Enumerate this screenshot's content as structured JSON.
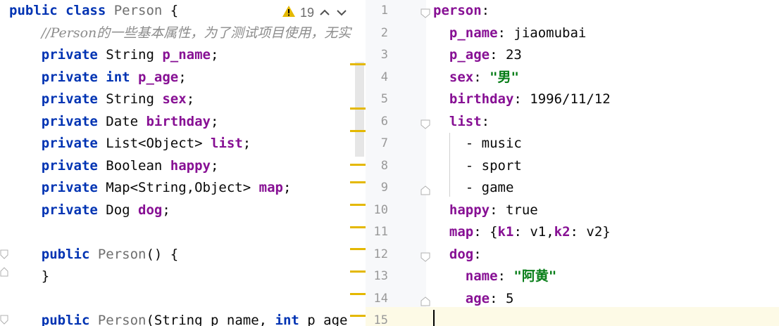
{
  "left_editor": {
    "warning": {
      "icon": "warning-triangle-icon",
      "count": "19",
      "color": "#e4b800"
    },
    "lines": [
      [
        {
          "t": "public ",
          "c": "kw"
        },
        {
          "t": "class ",
          "c": "kw"
        },
        {
          "t": "Person",
          "c": "gray"
        },
        {
          "t": " {",
          "c": "pun"
        }
      ],
      [
        {
          "t": "    ",
          "c": "pun"
        },
        {
          "t": "//Person的一些基本属性，为了测试项目使用，无实",
          "c": "cmt"
        }
      ],
      [
        {
          "t": "    ",
          "c": "pun"
        },
        {
          "t": "private ",
          "c": "kw"
        },
        {
          "t": "String ",
          "c": "ty"
        },
        {
          "t": "p_name",
          "c": "fld"
        },
        {
          "t": ";",
          "c": "pun"
        }
      ],
      [
        {
          "t": "    ",
          "c": "pun"
        },
        {
          "t": "private ",
          "c": "kw"
        },
        {
          "t": "int ",
          "c": "kw"
        },
        {
          "t": "p_age",
          "c": "fld"
        },
        {
          "t": ";",
          "c": "pun"
        }
      ],
      [
        {
          "t": "    ",
          "c": "pun"
        },
        {
          "t": "private ",
          "c": "kw"
        },
        {
          "t": "String ",
          "c": "ty"
        },
        {
          "t": "sex",
          "c": "fld"
        },
        {
          "t": ";",
          "c": "pun"
        }
      ],
      [
        {
          "t": "    ",
          "c": "pun"
        },
        {
          "t": "private ",
          "c": "kw"
        },
        {
          "t": "Date ",
          "c": "ty"
        },
        {
          "t": "birthday",
          "c": "fld"
        },
        {
          "t": ";",
          "c": "pun"
        }
      ],
      [
        {
          "t": "    ",
          "c": "pun"
        },
        {
          "t": "private ",
          "c": "kw"
        },
        {
          "t": "List<Object> ",
          "c": "ty"
        },
        {
          "t": "list",
          "c": "fld"
        },
        {
          "t": ";",
          "c": "pun"
        }
      ],
      [
        {
          "t": "    ",
          "c": "pun"
        },
        {
          "t": "private ",
          "c": "kw"
        },
        {
          "t": "Boolean ",
          "c": "ty"
        },
        {
          "t": "happy",
          "c": "fld"
        },
        {
          "t": ";",
          "c": "pun"
        }
      ],
      [
        {
          "t": "    ",
          "c": "pun"
        },
        {
          "t": "private ",
          "c": "kw"
        },
        {
          "t": "Map<String,Object> ",
          "c": "ty"
        },
        {
          "t": "map",
          "c": "fld"
        },
        {
          "t": ";",
          "c": "pun"
        }
      ],
      [
        {
          "t": "    ",
          "c": "pun"
        },
        {
          "t": "private ",
          "c": "kw"
        },
        {
          "t": "Dog ",
          "c": "ty"
        },
        {
          "t": "dog",
          "c": "fld"
        },
        {
          "t": ";",
          "c": "pun"
        }
      ],
      [],
      [
        {
          "t": "    ",
          "c": "pun"
        },
        {
          "t": "public ",
          "c": "kw"
        },
        {
          "t": "Person",
          "c": "gray"
        },
        {
          "t": "() {",
          "c": "pun"
        }
      ],
      [
        {
          "t": "    }",
          "c": "pun"
        }
      ],
      [],
      [
        {
          "t": "    ",
          "c": "pun"
        },
        {
          "t": "public ",
          "c": "kw"
        },
        {
          "t": "Person",
          "c": "gray"
        },
        {
          "t": "(String p_name, ",
          "c": "pun"
        },
        {
          "t": "int ",
          "c": "kw"
        },
        {
          "t": "p_age",
          "c": "pun"
        }
      ]
    ]
  },
  "right_editor": {
    "line_numbers": [
      "1",
      "2",
      "3",
      "4",
      "5",
      "6",
      "7",
      "8",
      "9",
      "10",
      "11",
      "12",
      "13",
      "14",
      "15"
    ],
    "lines": [
      [
        {
          "t": "person",
          "c": "ykey"
        },
        {
          "t": ":",
          "c": "yval"
        }
      ],
      [
        {
          "t": "  ",
          "c": "yval"
        },
        {
          "t": "p_name",
          "c": "ykey"
        },
        {
          "t": ": jiaomubai",
          "c": "yval"
        }
      ],
      [
        {
          "t": "  ",
          "c": "yval"
        },
        {
          "t": "p_age",
          "c": "ykey"
        },
        {
          "t": ": 23",
          "c": "yval"
        }
      ],
      [
        {
          "t": "  ",
          "c": "yval"
        },
        {
          "t": "sex",
          "c": "ykey"
        },
        {
          "t": ": ",
          "c": "yval"
        },
        {
          "t": "\"男\"",
          "c": "ystr"
        }
      ],
      [
        {
          "t": "  ",
          "c": "yval"
        },
        {
          "t": "birthday",
          "c": "ykey"
        },
        {
          "t": ": 1996/11/12",
          "c": "yval"
        }
      ],
      [
        {
          "t": "  ",
          "c": "yval"
        },
        {
          "t": "list",
          "c": "ykey"
        },
        {
          "t": ":",
          "c": "yval"
        }
      ],
      [
        {
          "t": "    - music",
          "c": "yval"
        }
      ],
      [
        {
          "t": "    - sport",
          "c": "yval"
        }
      ],
      [
        {
          "t": "    - game",
          "c": "yval"
        }
      ],
      [
        {
          "t": "  ",
          "c": "yval"
        },
        {
          "t": "happy",
          "c": "ykey"
        },
        {
          "t": ": true",
          "c": "yval"
        }
      ],
      [
        {
          "t": "  ",
          "c": "yval"
        },
        {
          "t": "map",
          "c": "ykey"
        },
        {
          "t": ": {",
          "c": "yval"
        },
        {
          "t": "k1",
          "c": "ykey"
        },
        {
          "t": ": v1,",
          "c": "yval"
        },
        {
          "t": "k2",
          "c": "ykey"
        },
        {
          "t": ": v2}",
          "c": "yval"
        }
      ],
      [
        {
          "t": "  ",
          "c": "yval"
        },
        {
          "t": "dog",
          "c": "ykey"
        },
        {
          "t": ":",
          "c": "yval"
        }
      ],
      [
        {
          "t": "    ",
          "c": "yval"
        },
        {
          "t": "name",
          "c": "ykey"
        },
        {
          "t": ": ",
          "c": "yval"
        },
        {
          "t": "\"阿黄\"",
          "c": "ystr"
        }
      ],
      [
        {
          "t": "    ",
          "c": "yval"
        },
        {
          "t": "age",
          "c": "ykey"
        },
        {
          "t": ": 5",
          "c": "yval"
        }
      ],
      []
    ]
  }
}
